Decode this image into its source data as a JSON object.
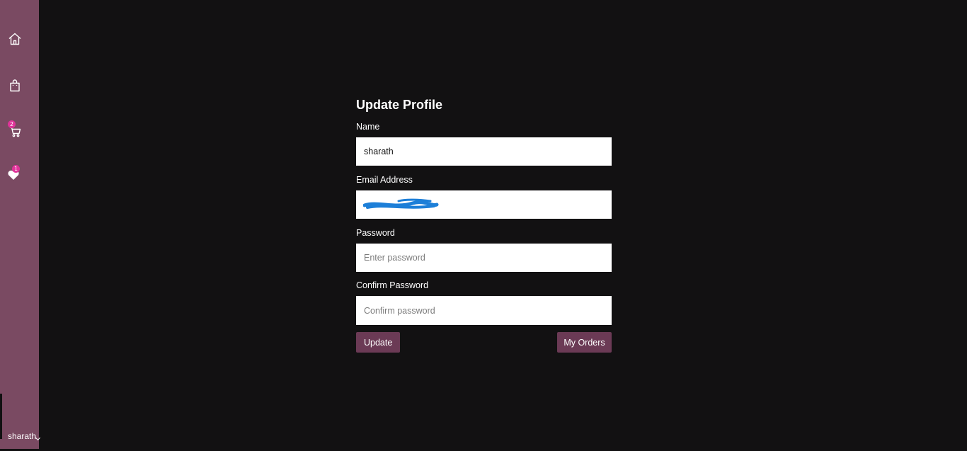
{
  "sidebar": {
    "nav": [
      {
        "icon": "home-icon"
      },
      {
        "icon": "shopping-bag-icon"
      },
      {
        "icon": "cart-icon",
        "badge": "2"
      },
      {
        "icon": "heart-icon",
        "badge": "1"
      }
    ],
    "user": {
      "name": "sharath"
    }
  },
  "form": {
    "title": "Update Profile",
    "name": {
      "label": "Name",
      "value": "sharath"
    },
    "email": {
      "label": "Email Address",
      "value": ""
    },
    "password": {
      "label": "Password",
      "placeholder": "Enter password"
    },
    "confirm_password": {
      "label": "Confirm Password",
      "placeholder": "Confirm password"
    },
    "update_label": "Update",
    "orders_label": "My Orders"
  },
  "colors": {
    "background": "#121112",
    "sidebar": "#7a4a62",
    "button": "#6b3a55",
    "badge": "#e0339a",
    "redaction": "#1d7fd8"
  }
}
